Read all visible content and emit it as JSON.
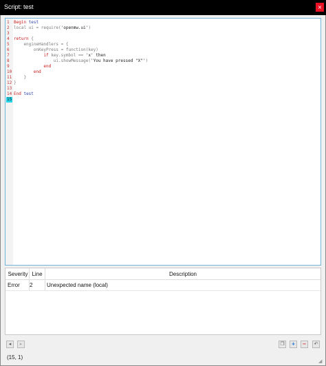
{
  "window": {
    "title": "Script: test",
    "close_glyph": "×"
  },
  "editor": {
    "current_line": 15,
    "lines": [
      {
        "num": "1",
        "segments": [
          {
            "t": "Begin",
            "c": "kw-red"
          },
          {
            "t": " test",
            "c": "kw-blue"
          }
        ]
      },
      {
        "num": "2",
        "segments": [
          {
            "t": "local ui = require(",
            "c": ""
          },
          {
            "t": "'openmw.ui'",
            "c": "str"
          },
          {
            "t": ")",
            "c": ""
          }
        ]
      },
      {
        "num": "3",
        "segments": []
      },
      {
        "num": "4",
        "segments": [
          {
            "t": "return",
            "c": "kw-red"
          },
          {
            "t": " {",
            "c": ""
          }
        ]
      },
      {
        "num": "5",
        "segments": [
          {
            "t": "    engineHandlers = {",
            "c": ""
          }
        ]
      },
      {
        "num": "6",
        "segments": [
          {
            "t": "        onKeyPress = function(key)",
            "c": ""
          }
        ]
      },
      {
        "num": "7",
        "segments": [
          {
            "t": "            ",
            "c": ""
          },
          {
            "t": "if",
            "c": "kw-red"
          },
          {
            "t": " key.symbol == ",
            "c": ""
          },
          {
            "t": "'x'",
            "c": "str"
          },
          {
            "t": " then",
            "c": "str"
          }
        ]
      },
      {
        "num": "8",
        "segments": [
          {
            "t": "                ui.showMessage(",
            "c": ""
          },
          {
            "t": "'You have pressed \"X\"'",
            "c": "str"
          },
          {
            "t": ")",
            "c": ""
          }
        ]
      },
      {
        "num": "9",
        "segments": [
          {
            "t": "            ",
            "c": ""
          },
          {
            "t": "end",
            "c": "kw-red"
          }
        ]
      },
      {
        "num": "10",
        "segments": [
          {
            "t": "        ",
            "c": ""
          },
          {
            "t": "end",
            "c": "kw-red"
          }
        ]
      },
      {
        "num": "11",
        "segments": [
          {
            "t": "    }",
            "c": ""
          }
        ]
      },
      {
        "num": "12",
        "segments": [
          {
            "t": "}",
            "c": ""
          }
        ]
      },
      {
        "num": "13",
        "segments": []
      },
      {
        "num": "14",
        "segments": [
          {
            "t": "End",
            "c": "kw-red"
          },
          {
            "t": " test",
            "c": "kw-blue"
          }
        ]
      },
      {
        "num": "15",
        "segments": []
      }
    ]
  },
  "errors": {
    "columns": {
      "severity": "Severity",
      "line": "Line",
      "description": "Description"
    },
    "rows": [
      {
        "severity": "Error",
        "line": "2",
        "description": "Unexpected name (local)"
      }
    ]
  },
  "toolbar": {
    "prev_icon": "chevron-left-icon",
    "next_icon": "chevron-right-icon",
    "copy_icon": "copy-icon",
    "add_icon": "plus-icon",
    "remove_icon": "minus-icon",
    "undo_icon": "undo-icon",
    "prev_glyph": "◂",
    "next_glyph": "▸",
    "copy_glyph": "❐",
    "add_glyph": "+",
    "remove_glyph": "−",
    "undo_glyph": "↶"
  },
  "status": {
    "cursor": "(15, 1)"
  },
  "colors": {
    "title_bar": "#000000",
    "close_button": "#e81123",
    "editor_border": "#6fb5d9",
    "current_line_highlight": "#25d3e6",
    "keyword": "#c81818",
    "identifier": "#2a3fae"
  }
}
